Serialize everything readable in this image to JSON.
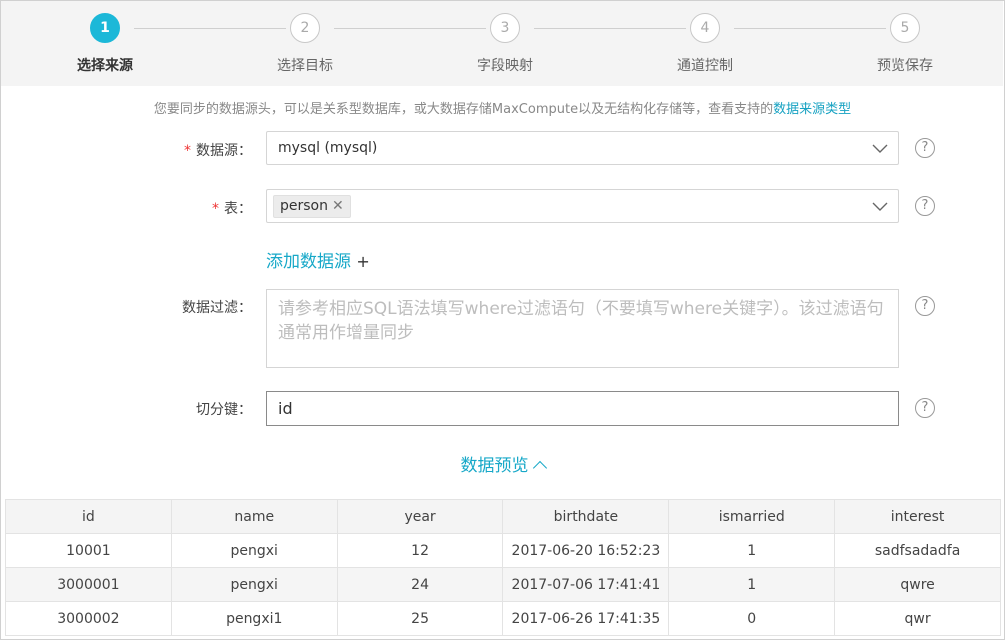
{
  "steps": [
    {
      "num": "1",
      "label": "选择来源"
    },
    {
      "num": "2",
      "label": "选择目标"
    },
    {
      "num": "3",
      "label": "字段映射"
    },
    {
      "num": "4",
      "label": "通道控制"
    },
    {
      "num": "5",
      "label": "预览保存"
    }
  ],
  "hint": {
    "text": "您要同步的数据源头，可以是关系型数据库，或大数据存储MaxCompute以及无结构化存储等，查看支持的",
    "link": "数据来源类型"
  },
  "form": {
    "datasource": {
      "required_mark": "*",
      "label": "数据源：",
      "value": "mysql (mysql)"
    },
    "table": {
      "required_mark": "*",
      "label": "表：",
      "tag": "person"
    },
    "add_source": {
      "label": "添加数据源",
      "plus": "+"
    },
    "filter": {
      "label": "数据过滤：",
      "placeholder": "请参考相应SQL语法填写where过滤语句（不要填写where关键字）。该过滤语句通常用作增量同步"
    },
    "split_key": {
      "label": "切分键：",
      "value": "id"
    },
    "help_icon": "?"
  },
  "preview": {
    "label": "数据预览"
  },
  "table_data": {
    "columns": [
      "id",
      "name",
      "year",
      "birthdate",
      "ismarried",
      "interest"
    ],
    "rows": [
      [
        "10001",
        "pengxi",
        "12",
        "2017-06-20 16:52:23",
        "1",
        "sadfsadadfa"
      ],
      [
        "3000001",
        "pengxi",
        "24",
        "2017-07-06 17:41:41",
        "1",
        "qwre"
      ],
      [
        "3000002",
        "pengxi1",
        "25",
        "2017-06-26 17:41:35",
        "0",
        "qwr"
      ]
    ]
  },
  "colors": {
    "accent": "#1cb8d8",
    "link": "#17a8c8",
    "required": "#e33333"
  }
}
